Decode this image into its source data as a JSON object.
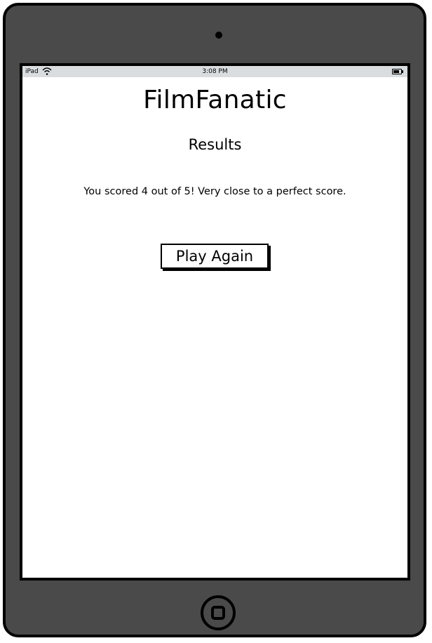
{
  "status_bar": {
    "device": "iPad",
    "time": "3:08 PM",
    "wifi_icon": "wifi-icon",
    "battery_icon": "battery-icon"
  },
  "app": {
    "title": "FilmFanatic",
    "heading": "Results",
    "message": "You scored 4 out of 5! Very close to a perfect score.",
    "play_again_label": "Play Again"
  },
  "colors": {
    "device_body": "#4a4a4a",
    "status_bar": "#d9dde0",
    "screen": "#ffffff"
  }
}
